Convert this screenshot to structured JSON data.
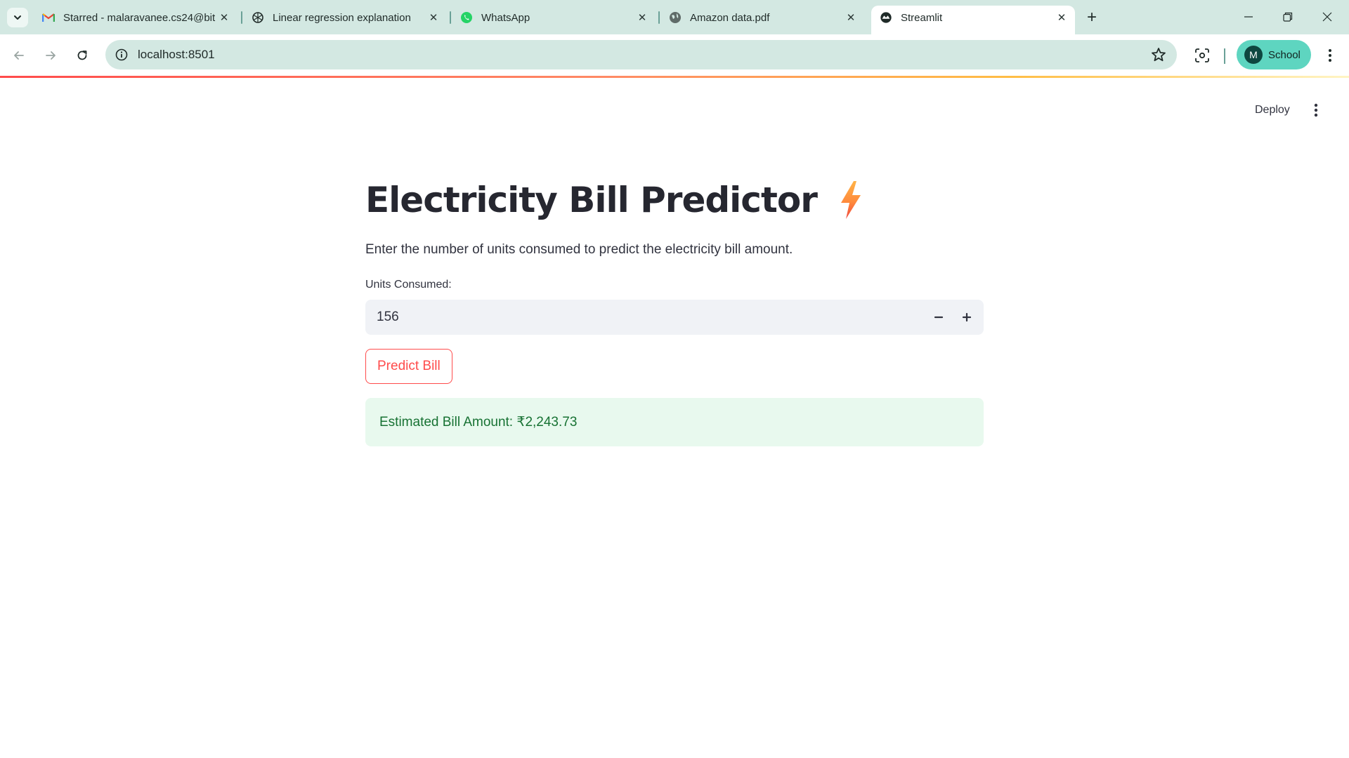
{
  "browser": {
    "tabs": [
      {
        "title": "Starred - malaravanee.cs24@bit",
        "icon": "gmail-icon"
      },
      {
        "title": "Linear regression explanation",
        "icon": "chatgpt-icon"
      },
      {
        "title": "WhatsApp",
        "icon": "whatsapp-icon"
      },
      {
        "title": "Amazon data.pdf",
        "icon": "globe-icon"
      },
      {
        "title": "Streamlit",
        "icon": "streamlit-icon",
        "active": true
      }
    ],
    "url": "localhost:8501",
    "profile": {
      "initial": "M",
      "name": "School"
    }
  },
  "app": {
    "deploy_label": "Deploy",
    "title": "Electricity Bill Predictor",
    "title_icon": "lightning-bolt-icon",
    "description": "Enter the number of units consumed to predict the electricity bill amount.",
    "units_label": "Units Consumed:",
    "units_value": "156",
    "predict_label": "Predict Bill",
    "result_text": "Estimated Bill Amount: ₹2,243.73"
  },
  "colors": {
    "accent": "#ff4b4b",
    "success_bg": "#e8f9ee",
    "success_text": "#177233",
    "chrome_bg": "#d3e8e2",
    "profile_bg": "#5ed5c0"
  }
}
